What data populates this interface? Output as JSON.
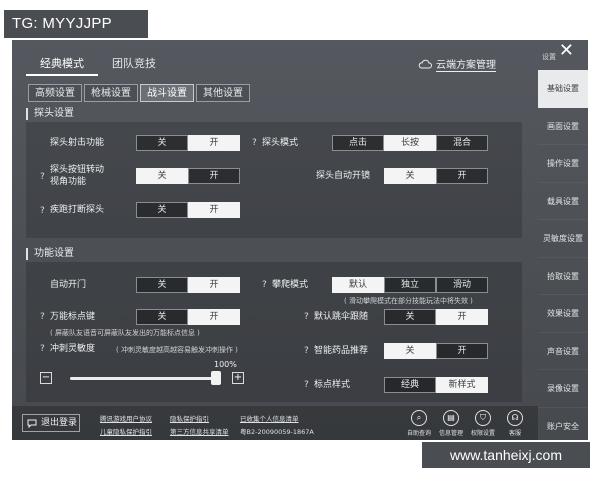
{
  "watermarks": {
    "top": "TG: MYYJJPP",
    "bottom": "www.tanheixj.com"
  },
  "window": {
    "close_hint": "设置",
    "close_glyph": "✕"
  },
  "main_tabs": [
    {
      "label": "经典模式"
    },
    {
      "label": "团队竞技"
    }
  ],
  "cloud": {
    "label": "云端方案管理",
    "icon": "cloud-icon"
  },
  "sub_tabs": [
    {
      "label": "高频设置"
    },
    {
      "label": "枪械设置"
    },
    {
      "label": "战斗设置"
    },
    {
      "label": "其他设置"
    }
  ],
  "sections": {
    "peek": "探头设置",
    "function": "功能设置"
  },
  "peek": {
    "fire": {
      "label": "探头射击功能",
      "options": [
        "关",
        "开"
      ],
      "selected": 1
    },
    "mode": {
      "label": "探头模式",
      "options": [
        "点击",
        "长按",
        "混合"
      ],
      "selected": 1
    },
    "turn": {
      "label1": "探头按钮转动",
      "label2": "视角功能",
      "options": [
        "关",
        "开"
      ],
      "selected": 0
    },
    "auto_scope": {
      "label": "探头自动开镜",
      "options": [
        "关",
        "开"
      ],
      "selected": 0
    },
    "sprint": {
      "label": "疾跑打断探头",
      "options": [
        "关",
        "开"
      ],
      "selected": 1
    }
  },
  "func": {
    "door": {
      "label": "自动开门",
      "options": [
        "关",
        "开"
      ],
      "selected": 1
    },
    "climb": {
      "label": "攀爬模式",
      "options": [
        "默认",
        "独立",
        "滑动"
      ],
      "selected": 0,
      "note": "( 滑动攀爬模式在部分技能玩法中将失效 )"
    },
    "marker": {
      "label": "万能标点键",
      "options": [
        "关",
        "开"
      ],
      "selected": 1,
      "note": "( 屏蔽队友语音可屏蔽队友发出的万能标点信息 )"
    },
    "parachute": {
      "label": "默认跳伞跟随",
      "options": [
        "关",
        "开"
      ],
      "selected": 1
    },
    "sprint_sens": {
      "label": "冲刺灵敏度",
      "note": "( 冲刺灵敏度越高越容易触发冲刺操作 )",
      "value_label": "100%",
      "fraction": 0.97
    },
    "medicine": {
      "label": "智能药品推荐",
      "options": [
        "关",
        "开"
      ],
      "selected": 0
    },
    "marker_style": {
      "label": "标点样式",
      "options": [
        "经典",
        "新样式"
      ],
      "selected": 1
    }
  },
  "sidebar": [
    "基础设置",
    "画面设置",
    "操作设置",
    "载具设置",
    "灵敏度设置",
    "拾取设置",
    "效果设置",
    "声音设置",
    "录像设置",
    "账户安全"
  ],
  "sidebar_active": 0,
  "footer": {
    "logout": "退出登录",
    "links": [
      "腾讯游戏用户协议",
      "隐私保护指引",
      "已收集个人信息清单",
      "儿童隐私保护指引",
      "第三方信息共享清单",
      "粤B2-20090059-1867A"
    ],
    "buttons": [
      "自助查询",
      "信息管理",
      "权限设置",
      "客服"
    ]
  }
}
